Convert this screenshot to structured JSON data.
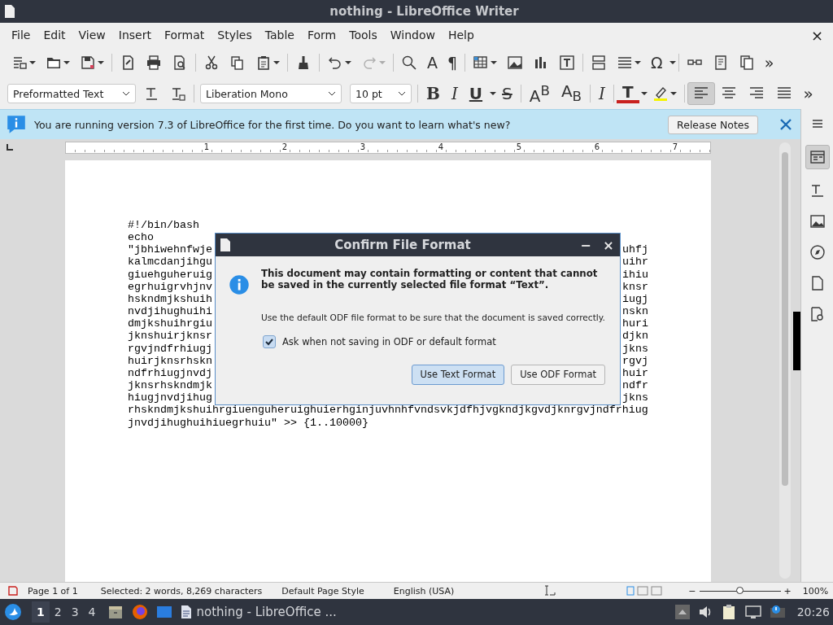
{
  "window": {
    "title": "nothing - LibreOffice Writer",
    "close": "×"
  },
  "menu": [
    "File",
    "Edit",
    "View",
    "Insert",
    "Format",
    "Styles",
    "Table",
    "Form",
    "Tools",
    "Window",
    "Help"
  ],
  "standard_toolbar": {
    "redo_disabled": true,
    "glyphs": [
      "A",
      "¶",
      "Ω",
      "»"
    ]
  },
  "formatting_toolbar": {
    "paragraph_style": "Preformatted Text",
    "font_name": "Liberation Mono",
    "font_size": "10 pt",
    "glyphs": [
      "B",
      "I",
      "U",
      "S",
      "A$^{B}$",
      "A$_{B}$",
      "I",
      "T",
      "»"
    ],
    "alignments": [
      {
        "selected": true
      },
      {
        "selected": false
      },
      {
        "selected": false
      },
      {
        "selected": false
      }
    ]
  },
  "infobar": {
    "message": "You are running version 7.3 of LibreOffice for the first time. Do you want to learn what's new?",
    "button": "Release Notes"
  },
  "ruler_labels": [
    "1",
    "2",
    "3",
    "4",
    "5",
    "6",
    "7"
  ],
  "document_lines": [
    {
      "left": "#!/bin/bash"
    },
    {
      "left": "echo"
    },
    {
      "left": "\"jbhiwehnfwje",
      "right": "uhfj"
    },
    {
      "left": "kalmcdanjihgu",
      "right": "uihr"
    },
    {
      "left": "giuehguheruig",
      "right": "ihiu"
    },
    {
      "left": "egrhuigrvhjnv",
      "right": "knsr"
    },
    {
      "left": "hskndmjkshuih",
      "right": "iugj"
    },
    {
      "left": "nvdjihughuihi",
      "right": "nskn"
    },
    {
      "left": "dmjkshuihrgiu",
      "right": "huri"
    },
    {
      "left": "jknshuirjknsr",
      "right": "djkn"
    },
    {
      "left": "rgvjndfrhiugj",
      "right": "jkns"
    },
    {
      "left": "huirjknsrhskn",
      "right": "rgvj"
    },
    {
      "left": "ndfrhiugjnvdj",
      "right": "huir"
    },
    {
      "left": "jknsrhskndmjk",
      "right": "ndfr"
    },
    {
      "left": "hiugjnvdjihug",
      "right": "jkns"
    },
    {
      "left": "rhskndmjkshuihrgiuenguheruighuierhginjuvhnhfvndsvkjdfhjvgkndjkgvdjknrgvjndfrhiug"
    },
    {
      "left": "jnvdjihughuihiuegrhuiu\" >> {1..10000}"
    }
  ],
  "dialog": {
    "title": "Confirm File Format",
    "controls": [
      "−",
      "×"
    ],
    "message": "This document may contain formatting or content that cannot be saved in the currently selected file format “Text”.",
    "detail": "Use the default ODF file format to be sure that the document is saved correctly.",
    "checkbox": {
      "label": "Ask when not saving in ODF or default format",
      "checked": true
    },
    "buttons": [
      {
        "label": "Use Text Format",
        "selected": true
      },
      {
        "label": "Use ODF Format",
        "selected": false
      }
    ]
  },
  "status_bar": {
    "page": "Page 1 of 1",
    "selection": "Selected: 2 words, 8,269 characters",
    "page_style": "Default Page Style",
    "language": "English (USA)",
    "zoom_out": "−",
    "zoom_in": "+",
    "zoom": {
      "level": 0.5
    },
    "zoom_value": "100%"
  },
  "taskbar": {
    "workspaces": [
      {
        "label": "1",
        "selected": true
      },
      {
        "label": "2",
        "selected": false
      },
      {
        "label": "3",
        "selected": false
      },
      {
        "label": "4",
        "selected": false
      }
    ],
    "task": "nothing - LibreOffice ...",
    "clock": "20:26"
  }
}
